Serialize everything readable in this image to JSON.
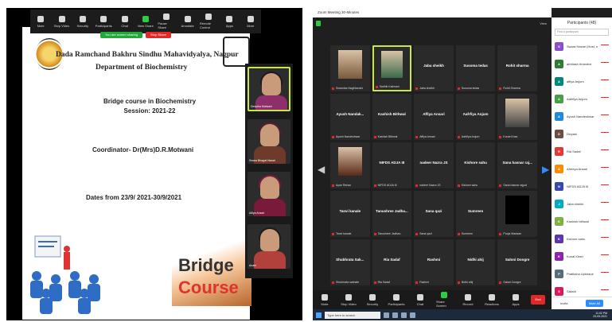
{
  "left": {
    "toolbar": [
      {
        "label": "Mute",
        "icon": "mic-icon"
      },
      {
        "label": "Stop Video",
        "icon": "camera-icon"
      },
      {
        "label": "Security",
        "icon": "shield-icon"
      },
      {
        "label": "Participants",
        "icon": "participants-icon"
      },
      {
        "label": "Chat",
        "icon": "chat-icon"
      },
      {
        "label": "New Share",
        "icon": "share-icon"
      },
      {
        "label": "Pause Share",
        "icon": "pause-icon"
      },
      {
        "label": "Annotate",
        "icon": "annotate-icon"
      },
      {
        "label": "Remote Control",
        "icon": "remote-icon"
      },
      {
        "label": "Apps",
        "icon": "apps-icon"
      },
      {
        "label": "More",
        "icon": "more-icon"
      }
    ],
    "share_banner": "You are screen sharing",
    "stop_share": "Stop Share",
    "slide": {
      "college": "Dada Ramchand Bakhru Sindhu Mahavidyalya, Nagpur",
      "department": "Department of Biochemistry",
      "course_line1": "Bridge course in Biochemistry",
      "course_line2": "Session: 2021-22",
      "coordinator": "Coordinator- Dr(Mrs)D.R.Motwani",
      "dates": "Dates from 23/9/ 2021-30/9/2021",
      "bridge_word1": "Bridge",
      "bridge_word2": "Course"
    },
    "gallery": [
      {
        "name": "Deepika Motwani"
      },
      {
        "name": "Swara Bhagat Hazari"
      },
      {
        "name": "Alfiya Ansari"
      },
      {
        "name": "Anam"
      }
    ]
  },
  "right": {
    "window_title": "Zoom Meeting 30-Minutes",
    "view_label": "View",
    "tiles": [
      {
        "name": "",
        "label": "Swarnika Nagbhanshi",
        "photo": true,
        "active": false
      },
      {
        "name": "",
        "label": "Sadhik Kalimani",
        "photo": true,
        "active": true
      },
      {
        "name": "Jaba sheikh",
        "label": "Jaba sheikh",
        "photo": false,
        "active": false
      },
      {
        "name": "Susoma tedas",
        "label": "Susoma tedas",
        "photo": false,
        "active": false
      },
      {
        "name": "Rohit sharma",
        "label": "Rohit Sharma",
        "photo": false,
        "active": false
      },
      {
        "name": "Ayush Nandak...",
        "label": "Ayush Nandeshwar",
        "photo": false,
        "active": false
      },
      {
        "name": "Kashish Bithwal",
        "label": "Kashish Bithwal",
        "photo": false,
        "active": false
      },
      {
        "name": "Affiya Ansari",
        "label": "Affiya Ansari",
        "photo": false,
        "active": false
      },
      {
        "name": "Aafrfiya Anjum",
        "label": "Aafrfiya Anjum",
        "photo": false,
        "active": false
      },
      {
        "name": "",
        "label": "Kunal Khan",
        "photo": true,
        "active": false
      },
      {
        "name": "",
        "label": "Ayan Rehan",
        "photo": true,
        "active": false
      },
      {
        "name": "NIFDS ADJA III",
        "label": "NIFDS ADJA III",
        "photo": false,
        "active": false
      },
      {
        "name": "nadeer Nazra JS",
        "label": "nadeer Nazra JS",
        "photo": false,
        "active": false
      },
      {
        "name": "Kishore sahu",
        "label": "Kishore sahu",
        "photo": false,
        "active": false
      },
      {
        "name": "Sana hasnar raj...",
        "label": "Sana hasnar rajput",
        "photo": false,
        "active": false
      },
      {
        "name": "Tanvi kanale",
        "label": "Tanvi kanale",
        "photo": false,
        "active": false
      },
      {
        "name": "Tanushree Jadha...",
        "label": "Tanushree Jadhao",
        "photo": false,
        "active": false
      },
      {
        "name": "Sana qazi",
        "label": "Sana qazi",
        "photo": false,
        "active": false
      },
      {
        "name": "Sumreen",
        "label": "Sumreen",
        "photo": false,
        "active": false
      },
      {
        "name": "",
        "label": "Pooja Madaan",
        "photo": true,
        "active": false
      },
      {
        "name": "Shubhrata Sak...",
        "label": "Shubhrata sakhale",
        "photo": false,
        "active": false
      },
      {
        "name": "Ria Sadaf",
        "label": "Ria Sadaf",
        "photo": false,
        "active": false
      },
      {
        "name": "Rashmi",
        "label": "Rashmi",
        "photo": false,
        "active": false
      },
      {
        "name": "Nidhi ahij",
        "label": "Nidhi ahij",
        "photo": false,
        "active": false
      },
      {
        "name": "Saloni Dongre",
        "label": "Saloni Dongre",
        "photo": false,
        "active": false
      }
    ],
    "toolbar": [
      {
        "label": "Mute",
        "icon": "mic-icon"
      },
      {
        "label": "Stop Video",
        "icon": "camera-icon"
      },
      {
        "label": "Security",
        "icon": "shield-icon"
      },
      {
        "label": "Participants",
        "icon": "participants-icon"
      },
      {
        "label": "Chat",
        "icon": "chat-icon"
      },
      {
        "label": "Share Screen",
        "icon": "share-icon"
      },
      {
        "label": "Record",
        "icon": "record-icon"
      },
      {
        "label": "Reactions",
        "icon": "reactions-icon"
      },
      {
        "label": "Apps",
        "icon": "apps-icon"
      }
    ],
    "end_label": "End",
    "taskbar": {
      "search_placeholder": "Type here to search",
      "time": "11:02 PM",
      "date": "23-09-2021"
    },
    "participants": {
      "header": "Participants (48)",
      "search_placeholder": "Find a participant",
      "rows": [
        {
          "initial": "S",
          "name": "Swara Hazari (Host, me)",
          "color": "#8c4ecb"
        },
        {
          "initial": "A",
          "name": "abhilash bhandve",
          "color": "#2e7d32"
        },
        {
          "initial": "A",
          "name": "affiya Anjum",
          "color": "#00897b"
        },
        {
          "initial": "A",
          "name": "Aafrfiya Anjum",
          "color": "#43a047"
        },
        {
          "initial": "A",
          "name": "Ayush Nandeshwar",
          "color": "#1e88e5"
        },
        {
          "initial": "D",
          "name": "Divyani",
          "color": "#6d4c41"
        },
        {
          "initial": "R",
          "name": "Ria Sadaf",
          "color": "#e53935"
        },
        {
          "initial": "A",
          "name": "Afreeya Ansari",
          "color": "#fb8c00"
        },
        {
          "initial": "N",
          "name": "NIFDS ADJA III",
          "color": "#3949ab"
        },
        {
          "initial": "J",
          "name": "Jaba sheikh",
          "color": "#00acc1"
        },
        {
          "initial": "K",
          "name": "Kashish bithwal",
          "color": "#7cb342"
        },
        {
          "initial": "K",
          "name": "Kishore sahu",
          "color": "#5e35b1"
        },
        {
          "initial": "K",
          "name": "Kunal Khan",
          "color": "#8e24aa"
        },
        {
          "initial": "P",
          "name": "Pratiksha Upkhane",
          "color": "#546e7a"
        },
        {
          "initial": "S",
          "name": "Sakshi",
          "color": "#d81b60"
        }
      ],
      "invite_label": "Invite",
      "mute_all_label": "Mute All"
    }
  }
}
